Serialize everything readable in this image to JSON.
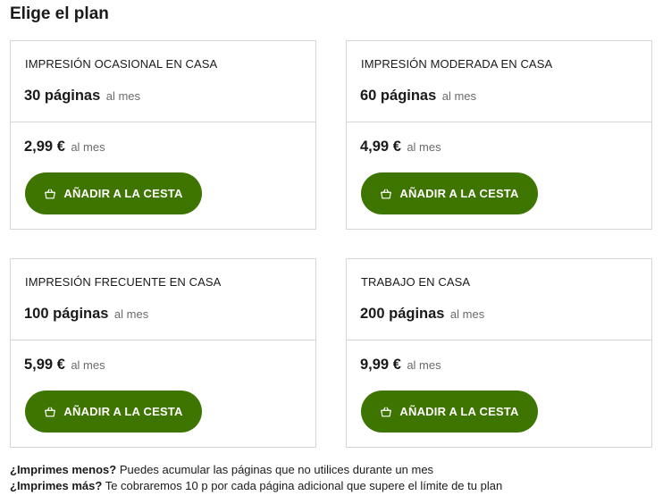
{
  "page": {
    "title": "Elige el plan"
  },
  "plans": [
    {
      "name": "IMPRESIÓN OCASIONAL EN CASA",
      "pages": "30 páginas",
      "pages_unit": "al mes",
      "price": "2,99 €",
      "price_unit": "al mes",
      "button": "AÑADIR A LA CESTA"
    },
    {
      "name": "IMPRESIÓN MODERADA EN CASA",
      "pages": "60 páginas",
      "pages_unit": "al mes",
      "price": "4,99 €",
      "price_unit": "al mes",
      "button": "AÑADIR A LA CESTA"
    },
    {
      "name": "IMPRESIÓN FRECUENTE EN CASA",
      "pages": "100 páginas",
      "pages_unit": "al mes",
      "price": "5,99 €",
      "price_unit": "al mes",
      "button": "AÑADIR A LA CESTA"
    },
    {
      "name": "TRABAJO EN CASA",
      "pages": "200 páginas",
      "pages_unit": "al mes",
      "price": "9,99 €",
      "price_unit": "al mes",
      "button": "AÑADIR A LA CESTA"
    }
  ],
  "notes": [
    {
      "question": "¿Imprimes menos?",
      "answer": "Puedes acumular las páginas que no utilices durante un mes"
    },
    {
      "question": "¿Imprimes más?",
      "answer": "Te cobraremos 10 p por cada página adicional que supere el límite de tu plan"
    }
  ],
  "icons": {
    "button_icon": "basket-icon"
  },
  "colors": {
    "button_bg": "#3e7400",
    "border": "#d6d6d6"
  }
}
